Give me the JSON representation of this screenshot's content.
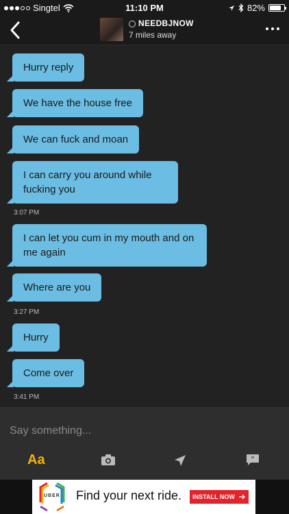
{
  "status_bar": {
    "carrier": "Singtel",
    "time": "11:10 PM",
    "battery": "82%",
    "battery_level": 0.82
  },
  "header": {
    "username": "NEEDBJNOW",
    "distance": "7 miles away"
  },
  "messages": [
    {
      "text": "Hurry reply"
    },
    {
      "text": "We have the house free"
    },
    {
      "text": "We can fuck and moan"
    },
    {
      "text": "I can carry you around while fucking you"
    },
    {
      "text": "I can let you cum in my mouth and on me again"
    },
    {
      "text": "Where are you"
    },
    {
      "text": "Hurry"
    },
    {
      "text": "Come over"
    }
  ],
  "timestamps": [
    "3:07 PM",
    "3:27 PM",
    "3:41 PM"
  ],
  "composer": {
    "placeholder": "Say something...",
    "text_button": "Aa",
    "icons": [
      "camera-icon",
      "location-arrow-icon",
      "quote-icon"
    ]
  },
  "ad": {
    "logo_text": "UBER",
    "headline": "Find your next ride.",
    "cta": "INSTALL NOW"
  },
  "colors": {
    "bubble": "#6cbde3",
    "accent": "#f7b500",
    "cta": "#e3232b"
  }
}
